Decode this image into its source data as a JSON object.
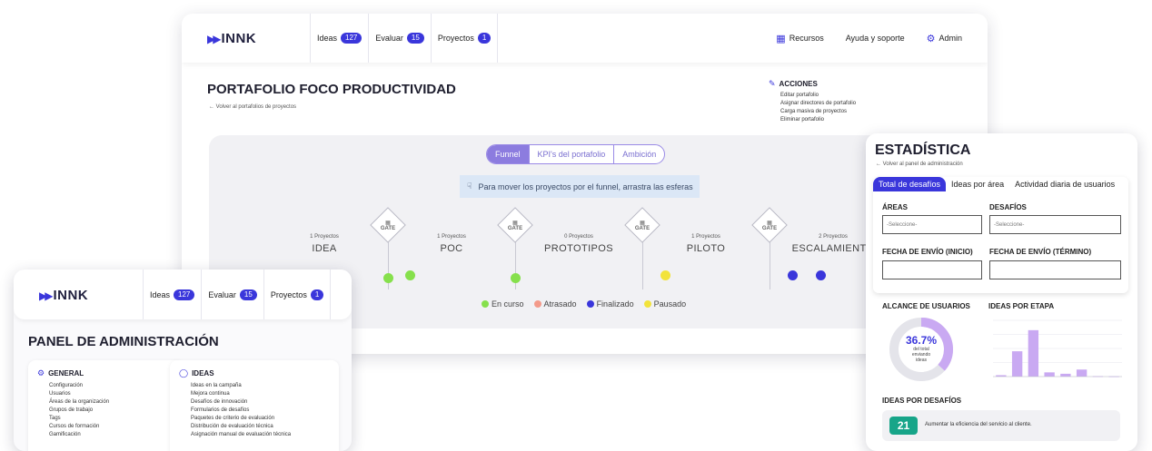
{
  "colors": {
    "accent": "#3a36db",
    "en_curso": "#86e04c",
    "atrasado": "#f39a8a",
    "finalizado": "#3a36db",
    "pausado": "#f2e33b",
    "donut": "#c9a9f2",
    "bars": "#c9a9f2",
    "badge": "#17a589"
  },
  "brand": {
    "name": "INNK"
  },
  "nav": {
    "tabs": [
      {
        "label": "Ideas",
        "count": "127"
      },
      {
        "label": "Evaluar",
        "count": "15"
      },
      {
        "label": "Proyectos",
        "count": "1"
      }
    ],
    "right": {
      "recursos": "Recursos",
      "ayuda": "Ayuda y soporte",
      "admin": "Admin"
    }
  },
  "portfolio": {
    "title": "PORTAFOLIO FOCO PRODUCTIVIDAD",
    "back": "Volver al portafolios de proyectos",
    "acciones": {
      "title": "ACCIONES",
      "items": [
        "Editar portafolio",
        "Asignar directores de portafolio",
        "Carga masiva de proyectos",
        "Eliminar portafolio"
      ]
    },
    "views": [
      "Funnel",
      "KPI's del portafolio",
      "Ambición"
    ],
    "hint": "Para mover los proyectos por el funnel, arrastra las esferas",
    "gate_label": "GATE",
    "stages": [
      {
        "count": "1 Proyectos",
        "name": "IDEA"
      },
      {
        "count": "1 Proyectos",
        "name": "POC"
      },
      {
        "count": "0 Proyectos",
        "name": "PROTOTIPOS"
      },
      {
        "count": "1 Proyectos",
        "name": "PILOTO"
      },
      {
        "count": "2 Proyectos",
        "name": "ESCALAMIENTO"
      }
    ],
    "legend": [
      "En curso",
      "Atrasado",
      "Finalizado",
      "Pausado"
    ]
  },
  "admin": {
    "title": "PANEL DE ADMINISTRACIÓN",
    "general": {
      "title": "GENERAL",
      "items": [
        "Configuración",
        "Usuarios",
        "Áreas de la organización",
        "Grupos de trabajo",
        "Tags",
        "Cursos de formación",
        "Gamificación"
      ]
    },
    "ideas": {
      "title": "IDEAS",
      "items": [
        "Ideas en la campaña",
        "Mejora continua",
        "Desafíos de innovación",
        "Formularios de desafíos",
        "Paquetes de criterio de evaluación",
        "Distribución de evaluación técnica",
        "Asignación manual de evaluación técnica"
      ]
    }
  },
  "stats": {
    "title": "ESTADÍSTICA",
    "back": "Volver al panel de administración",
    "tabs": [
      "Total de desafíos",
      "Ideas por área",
      "Actividad diaria de usuarios"
    ],
    "areas_label": "ÁREAS",
    "desafios_label": "DESAFÍOS",
    "select_placeholder": "-Seleccione-",
    "fecha_inicio_label": "FECHA DE ENVÍO (INICIO)",
    "fecha_termino_label": "FECHA DE ENVÍO (TÉRMINO)",
    "alcance_title": "ALCANCE DE USUARIOS",
    "donut_pct": "36.7%",
    "donut_sub": [
      "del total",
      "enviando",
      "ideas"
    ],
    "donut_value": 0.367,
    "etapa_title": "IDEAS POR ETAPA",
    "desafios_title": "IDEAS POR DESAFÍOS",
    "desafio_count": "21",
    "desafio_text": "Aumentar la eficiencia del servicio al cliente."
  },
  "chart_data": {
    "type": "bar",
    "title": "IDEAS POR ETAPA",
    "values": [
      1,
      18,
      33,
      3,
      2,
      5,
      0.3,
      0.2
    ],
    "ylim": [
      0,
      40
    ]
  }
}
